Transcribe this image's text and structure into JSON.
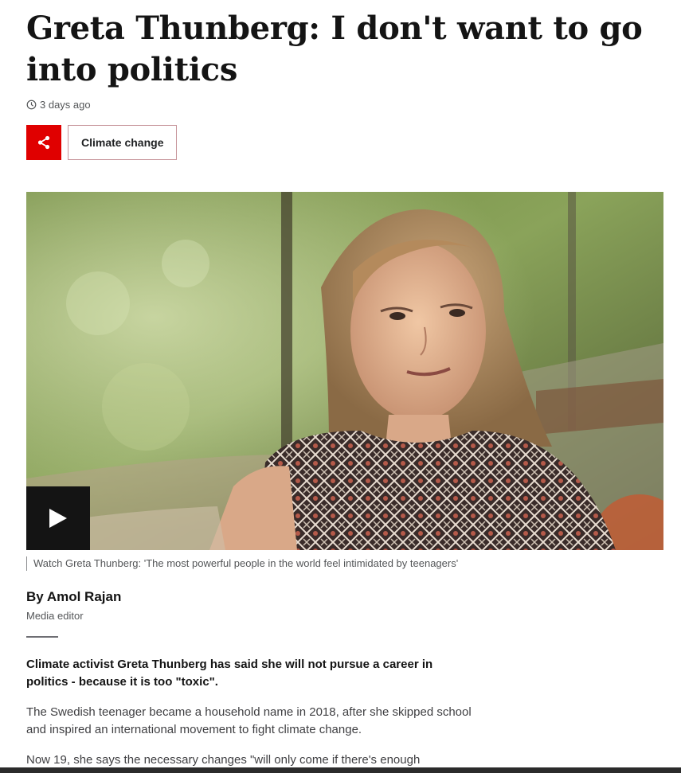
{
  "article": {
    "headline": "Greta Thunberg: I don't want to go into politics",
    "timestamp": "3 days ago",
    "topic_tag": "Climate change",
    "video_caption": "Watch Greta Thunberg: 'The most powerful people in the world feel intimidated by teenagers'",
    "author": "By Amol Rajan",
    "author_role": "Media editor",
    "lead": "Climate activist Greta Thunberg has said she will not pursue a career in politics - because it is too \"toxic\".",
    "paragraphs": [
      "The Swedish teenager became a household name in 2018, after she skipped school and inspired an international movement to fight climate change.",
      "Now 19, she says the necessary changes \"will only come if there's enough"
    ]
  },
  "icons": {
    "timestamp": "clock-icon",
    "share": "share-icon",
    "play": "play-icon"
  },
  "colors": {
    "share_button": "#e00000",
    "topic_border": "#c7959a",
    "headline": "#141414",
    "play_button": "#141414"
  }
}
